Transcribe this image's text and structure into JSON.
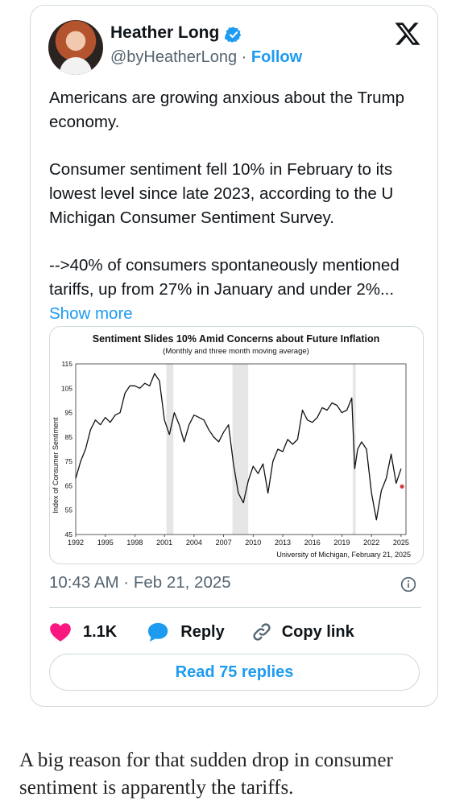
{
  "tweet": {
    "author_name": "Heather Long",
    "handle": "@byHeatherLong",
    "separator": "·",
    "follow_label": "Follow",
    "paragraphs": [
      "Americans are growing anxious about the Trump economy.",
      "Consumer sentiment fell 10% in February to its lowest level since late 2023, according to the U Michigan Consumer Sentiment Survey.",
      "-->40% of consumers spontaneously mentioned tariffs, up from 27% in January and under 2%..."
    ],
    "show_more_label": "Show more",
    "timestamp": "10:43 AM · Feb 21, 2025",
    "like_count": "1.1K",
    "reply_label": "Reply",
    "copy_link_label": "Copy link",
    "read_replies_label": "Read 75 replies",
    "colors": {
      "accent": "#1d9bf0",
      "like": "#f91880",
      "muted": "#536471",
      "border": "#cfd9de"
    }
  },
  "caption": "A big reason for that sudden drop in consumer sentiment is apparently the tariffs.",
  "icons": [
    "verified-badge-icon",
    "x-logo-icon",
    "info-icon",
    "heart-icon",
    "reply-icon",
    "link-icon"
  ],
  "chart_data": {
    "type": "line",
    "title": "Sentiment Slides 10% Amid Concerns about Future Inflation",
    "subtitle": "(Monthly and three month moving average)",
    "ylabel": "Index of Consumer Sentiment",
    "source": "University of Michigan, February 21, 2025",
    "ylim": [
      45,
      115
    ],
    "xlim": [
      1992,
      2025.5
    ],
    "yticks": [
      45,
      55,
      65,
      75,
      85,
      95,
      105,
      115
    ],
    "xticks": [
      1992,
      1995,
      1998,
      2001,
      2004,
      2007,
      2010,
      2013,
      2016,
      2019,
      2022,
      2025
    ],
    "recessions": [
      [
        2001.2,
        2001.9
      ],
      [
        2007.9,
        2009.5
      ],
      [
        2020.1,
        2020.4
      ]
    ],
    "series": [
      {
        "x": [
          1992,
          1992.5,
          1993,
          1993.5,
          1994,
          1994.5,
          1995,
          1995.5,
          1996,
          1996.5,
          1997,
          1997.5,
          1998,
          1998.5,
          1999,
          1999.5,
          2000,
          2000.5,
          2001,
          2001.5,
          2002,
          2002.5,
          2003,
          2003.5,
          2004,
          2004.5,
          2005,
          2005.5,
          2006,
          2006.5,
          2007,
          2007.5,
          2008,
          2008.5,
          2009,
          2009.5,
          2010,
          2010.5,
          2011,
          2011.5,
          2012,
          2012.5,
          2013,
          2013.5,
          2014,
          2014.5,
          2015,
          2015.5,
          2016,
          2016.5,
          2017,
          2017.5,
          2018,
          2018.5,
          2019,
          2019.5,
          2020,
          2020.3,
          2020.6,
          2021,
          2021.5,
          2022,
          2022.5,
          2023,
          2023.5,
          2024,
          2024.5,
          2025
        ],
        "values": [
          68,
          75,
          80,
          88,
          92,
          90,
          93,
          91,
          94,
          95,
          103,
          106,
          106,
          105,
          107,
          106,
          111,
          108,
          92,
          86,
          95,
          90,
          83,
          90,
          94,
          93,
          92,
          88,
          85,
          83,
          87,
          90,
          74,
          62,
          58,
          67,
          73,
          70,
          74,
          62,
          75,
          80,
          79,
          84,
          82,
          84,
          96,
          92,
          91,
          93,
          97,
          96,
          99,
          98,
          95,
          96,
          101,
          72,
          80,
          83,
          80,
          62,
          51,
          63,
          68,
          78,
          66,
          72
        ]
      },
      {
        "name": "Feb 2025",
        "x": [
          2025.1
        ],
        "values": [
          64.7
        ],
        "color": "#d63b3b"
      }
    ]
  }
}
